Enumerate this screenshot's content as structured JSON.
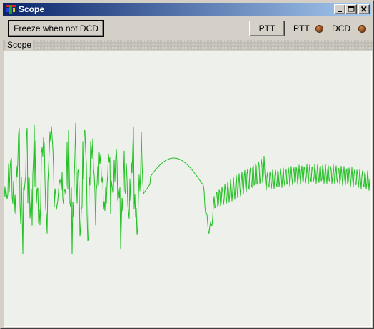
{
  "window": {
    "title": "Scope",
    "title_icon": "app-icon",
    "controls": [
      "minimize-icon",
      "maximize-icon",
      "close-icon"
    ]
  },
  "toolbar": {
    "freeze_label": "Freeze when not DCD",
    "ptt_button_label": "PTT",
    "ptt_indicator_label": "PTT",
    "dcd_indicator_label": "DCD",
    "indicator_color": "#7a3a10"
  },
  "scope": {
    "group_label": "Scope",
    "trace_color": "#22c022",
    "background_color": "#eef0ec"
  }
}
